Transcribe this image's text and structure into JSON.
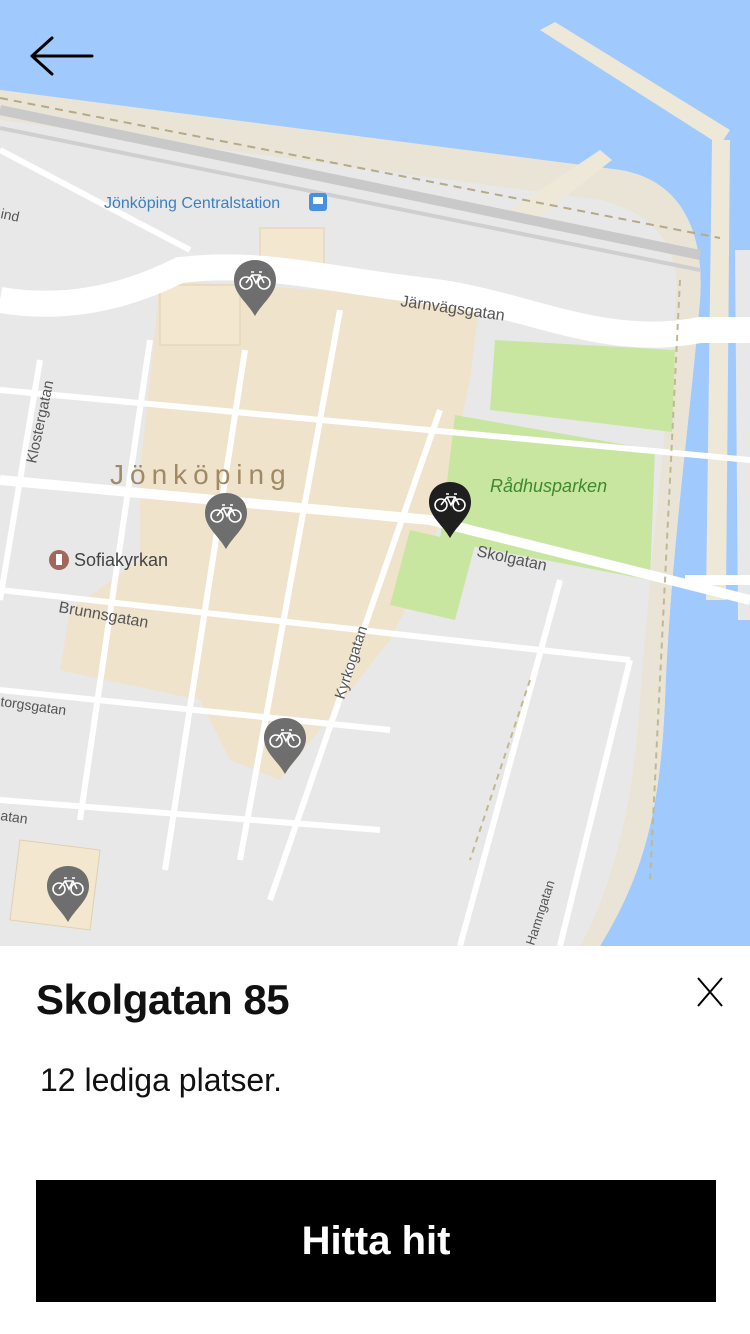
{
  "map": {
    "labels": {
      "station": "Jönköping Centralstation",
      "city": "Jönköping",
      "church": "Sofiakyrkan",
      "park": "Rådhusparken",
      "street_jarnvag": "Järnvägsgatan",
      "street_skol": "Skolgatan",
      "street_kloster": "Klostergatan",
      "street_brunns": "Brunnsgatan",
      "street_kyrko": "Kyrkogatan",
      "street_torgs": "torgsgatan",
      "street_hamn": "Hamngatan",
      "edge_ind": "ind",
      "edge_atan": "atan"
    },
    "pins": [
      {
        "name": "bike-station-pin-1",
        "selected": false
      },
      {
        "name": "bike-station-pin-2",
        "selected": false
      },
      {
        "name": "bike-station-pin-3",
        "selected": true
      },
      {
        "name": "bike-station-pin-4",
        "selected": false
      },
      {
        "name": "bike-station-pin-5",
        "selected": false
      }
    ],
    "colors": {
      "water": "#a0c9fd",
      "land": "#e8e8e8",
      "park": "#c8e6a0",
      "urban": "#efe3cc",
      "road": "#ffffff",
      "pin_default": "#6e6e6e",
      "pin_selected": "#1f1f1f"
    }
  },
  "sheet": {
    "title": "Skolgatan 85",
    "availability": "12 lediga platser.",
    "cta_label": "Hitta hit",
    "close_label": "X"
  },
  "icons": {
    "back": "arrow-left-icon",
    "pin": "bicycle-pin-icon"
  }
}
